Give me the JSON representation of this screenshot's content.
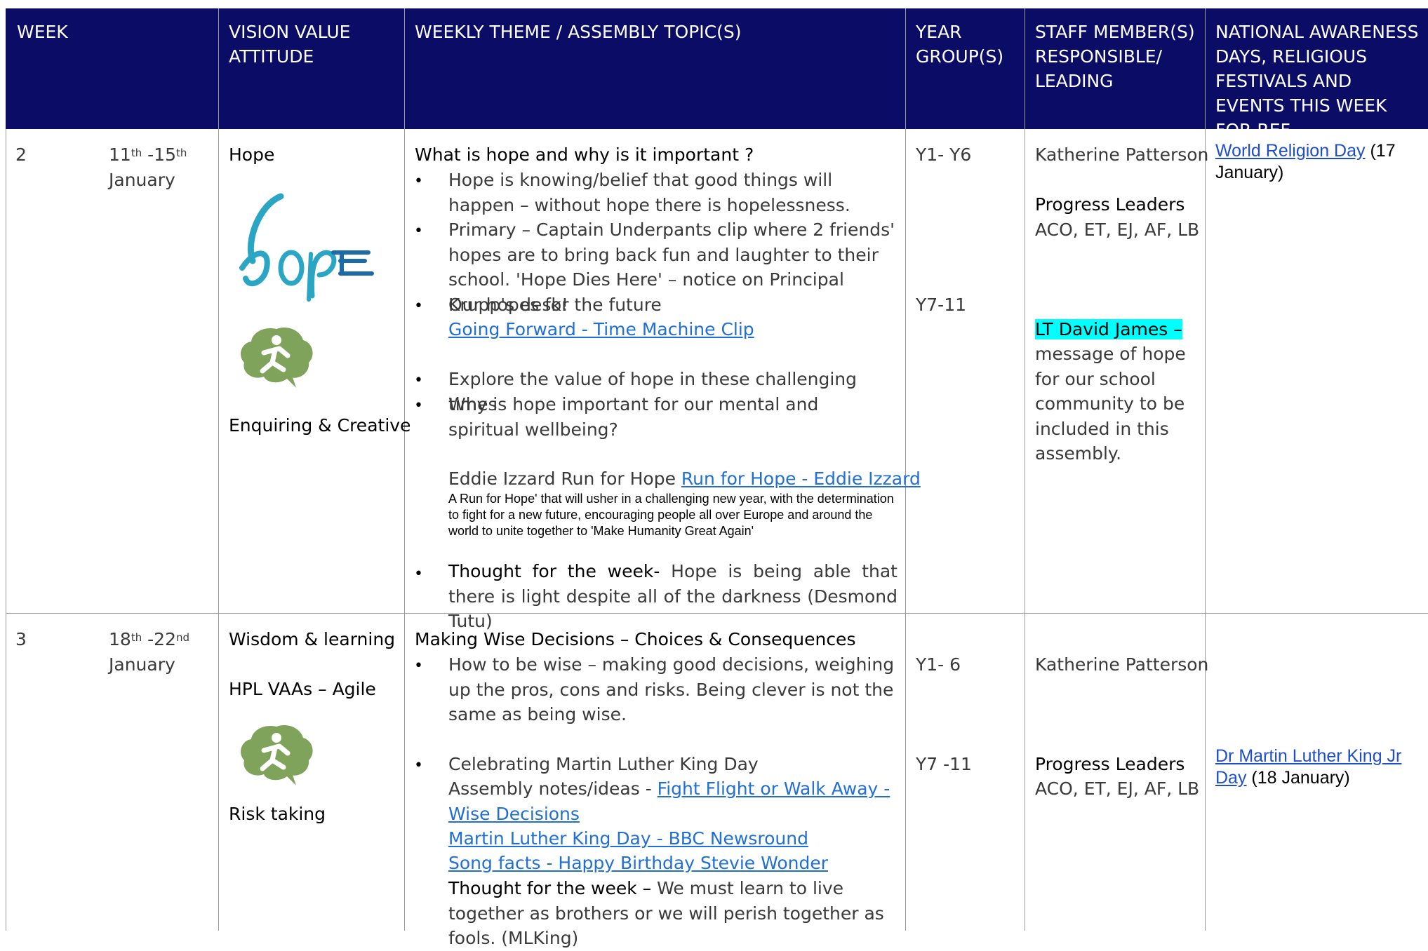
{
  "header": {
    "week": "WEEK",
    "vision": "VISION VALUE ATTITUDE",
    "theme": "WEEKLY THEME / ASSEMBLY TOPIC(S)",
    "year": "YEAR GROUP(S)",
    "staff": "STAFF MEMBER(S) RESPONSIBLE/ LEADING",
    "national": "NATIONAL AWARENESS DAYS, RELIGIOUS FESTIVALS AND EVENTS THIS WEEK FOR REF"
  },
  "rows": [
    {
      "week": "2",
      "date_start": "11",
      "date_start_sup": "th",
      "date_sep": " -15",
      "date_end_sup": "th",
      "month": "January",
      "value": "Hope",
      "logo_text": "hope",
      "attitude": "Enquiring & Creative",
      "theme_title": "What is hope and why is it important ?",
      "bullets": [
        "Hope is knowing/belief that good things will happen – without hope there is hopelessness.",
        "Primary – Captain Underpants clip where 2 friends' hopes are to bring back fun and laughter to their school. 'Hope Dies Here' – notice on Principal Krupp's desk!",
        "Our hopes for the future",
        "Explore the value of hope in these challenging times",
        "Why is hope important for our mental and spiritual wellbeing?"
      ],
      "link_time_machine": "Going Forward - Time Machine Clip",
      "eddie_text": "Eddie Izzard Run for Hope ",
      "link_run_hope": "Run for Hope - Eddie Izzard",
      "run_desc": "A Run for Hope' that will usher in a challenging new year, with the determination to fight for a new future, encouraging people all over Europe and around the world to unite together to 'Make Humanity Great Again'",
      "thought_label": "Thought for the week-",
      "thought_text": " Hope is being able that there is light despite all of the darkness (Desmond Tutu)",
      "year_1": "Y1- Y6",
      "year_2": "Y7-11",
      "staff_1": "Katherine Patterson",
      "staff_leaders": "Progress Leaders",
      "staff_initials": "ACO, ET, EJ, AF, LB",
      "staff_hl": "LT David James –",
      "staff_msg": "message of hope for our school community to be included in this assembly.",
      "nat_link": "World Religion Day",
      "nat_text": " (17 January)"
    },
    {
      "week": "3",
      "date_start": "18",
      "date_start_sup": "th",
      "date_sep": " -22",
      "date_end_sup": "nd",
      "month": "January",
      "value": "Wisdom & learning",
      "value_2": "HPL VAAs – Agile",
      "attitude": "Risk taking",
      "theme_title": "Making Wise Decisions – Choices & Consequences",
      "bullets": [
        "How to be wise – making good decisions, weighing up the pros, cons and risks. Being clever is not the same as being wise.",
        "Celebrating Martin Luther King Day"
      ],
      "assembly_label": "Assembly notes/ideas - ",
      "link_fight": "Fight Flight or Walk Away - Wise Decisions",
      "link_mlk": "Martin Luther King Day - BBC Newsround",
      "link_song": "Song facts - Happy Birthday Stevie Wonder",
      "thought_label": "Thought for the week –",
      "thought_text": " We must learn to live together as brothers or we will perish together as fools. (MLKing)",
      "year_1": "Y1- 6",
      "year_2": "Y7 -11",
      "staff_1": "Katherine Patterson",
      "staff_leaders": "Progress Leaders",
      "staff_initials": "ACO, ET, EJ, AF, LB",
      "nat_link": "Dr Martin Luther King Jr Day",
      "nat_text": " (18 January)"
    }
  ],
  "colors": {
    "header_bg": "#0b0c66",
    "link": "#1f6fd6",
    "highlight": "#00ffff",
    "icon_green": "#7fa35a",
    "logo_teal": "#2aa6c4"
  },
  "icons": [
    "hope-logo",
    "running-figure-icon"
  ]
}
